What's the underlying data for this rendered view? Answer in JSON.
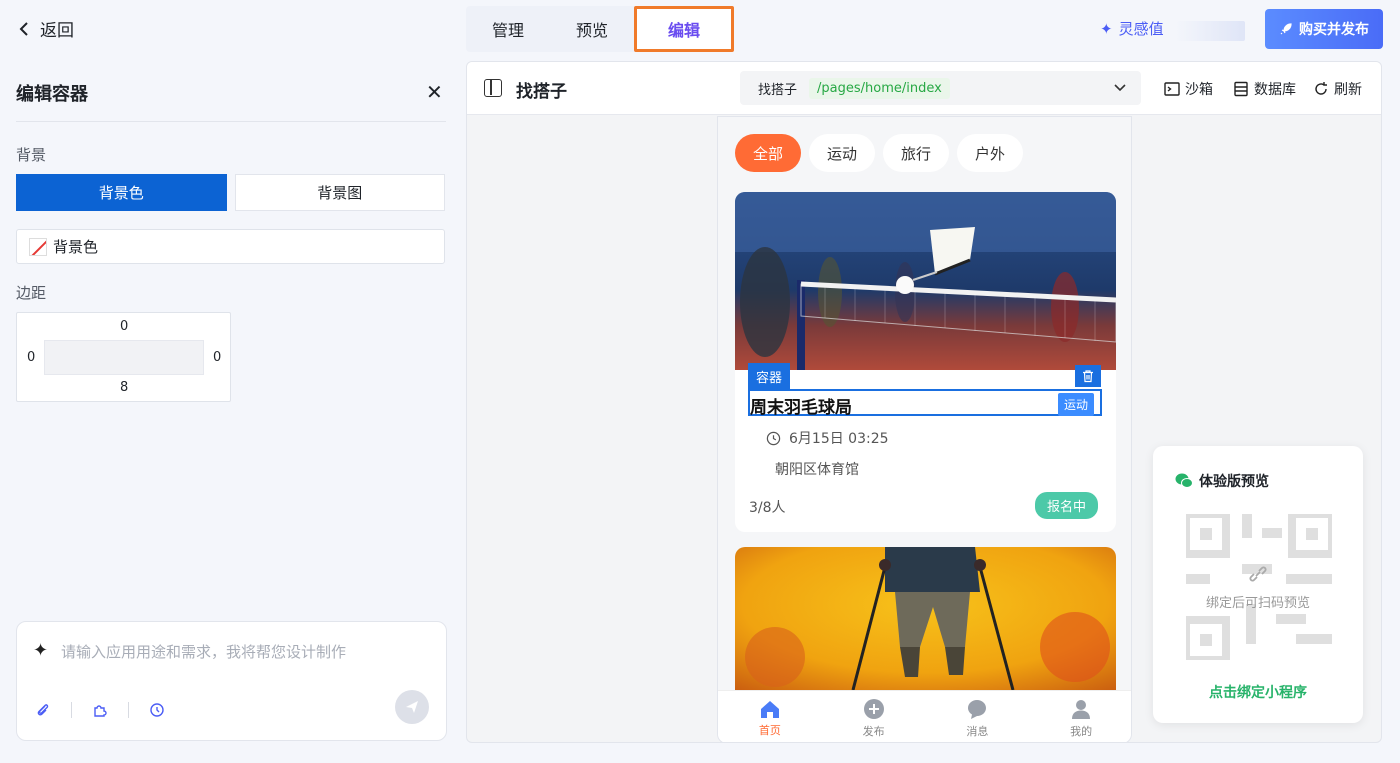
{
  "header": {
    "back_label": "返回",
    "tabs": [
      {
        "label": "管理"
      },
      {
        "label": "预览"
      },
      {
        "label": "编辑"
      }
    ],
    "inspire_label": "灵感值",
    "buy_label": "购买并发布"
  },
  "left_panel": {
    "title": "编辑容器",
    "background_section": "背景",
    "bg_color_tab": "背景色",
    "bg_image_tab": "背景图",
    "color_field_label": "背景色",
    "margin_section": "边距",
    "margin": {
      "top": "0",
      "left": "0",
      "right": "0",
      "bottom": "8"
    },
    "ai_placeholder": "请输入应用用途和需求，我将帮您设计制作"
  },
  "center": {
    "app_title": "找搭子",
    "page_name": "找搭子",
    "page_path": "/pages/home/index",
    "sandbox_label": "沙箱",
    "database_label": "数据库",
    "refresh_label": "刷新"
  },
  "phone": {
    "chips": [
      {
        "label": "全部"
      },
      {
        "label": "运动"
      },
      {
        "label": "旅行"
      },
      {
        "label": "户外"
      }
    ],
    "selection_tag": "容器",
    "event": {
      "title": "周末羽毛球局",
      "category": "运动",
      "time": "6月15日 03:25",
      "location": "朝阳区体育馆",
      "people": "3/8人",
      "status": "报名中"
    },
    "nav": [
      {
        "label": "首页"
      },
      {
        "label": "发布"
      },
      {
        "label": "消息"
      },
      {
        "label": "我的"
      }
    ]
  },
  "preview_card": {
    "title": "体验版预览",
    "hint": "绑定后可扫码预览",
    "bind_label": "点击绑定小程序"
  },
  "colors": {
    "accent_purple": "#6a4cf0",
    "primary_blue": "#0c63d3",
    "orange": "#ff6b35",
    "green": "#27b36a"
  }
}
